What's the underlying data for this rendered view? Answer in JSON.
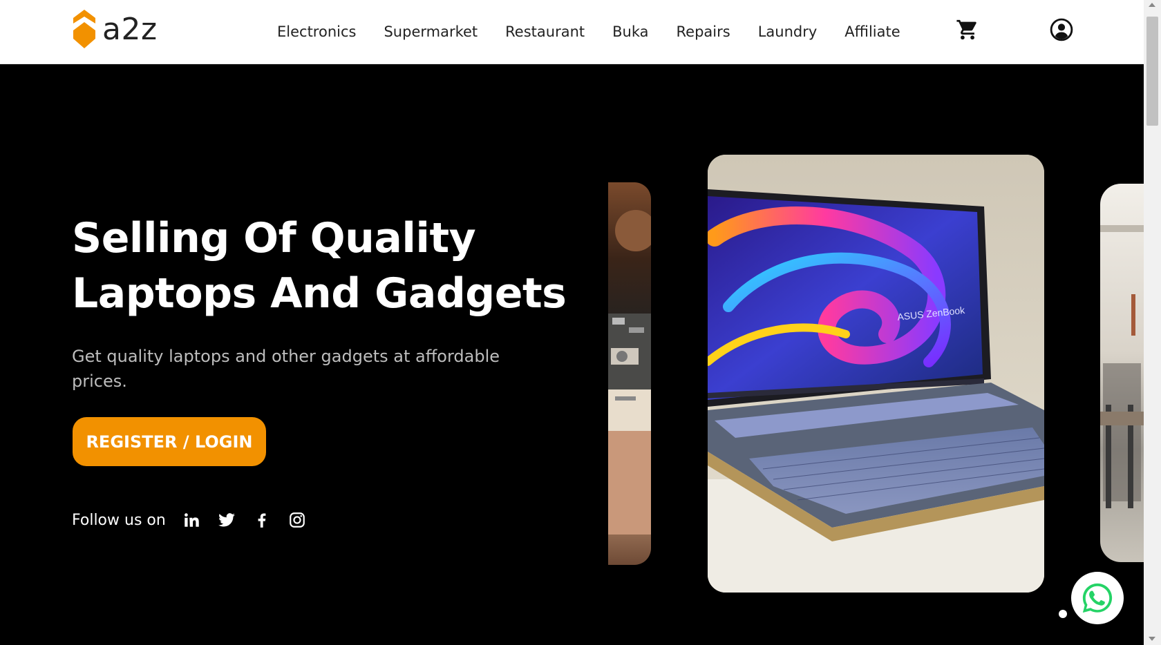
{
  "brand": {
    "name": "a2z",
    "accent": "#f29100"
  },
  "nav": {
    "items": [
      "Electronics",
      "Supermarket",
      "Restaurant",
      "Buka",
      "Repairs",
      "Laundry",
      "Affiliate"
    ]
  },
  "header_icons": [
    "cart-icon",
    "user-account-icon"
  ],
  "hero": {
    "title": "Selling Of Quality Laptops And Gadgets",
    "subtitle": "Get quality laptops and other gadgets at affordable prices.",
    "cta": "REGISTER / LOGIN",
    "follow_label": "Follow us on",
    "socials": [
      "linkedin-icon",
      "twitter-icon",
      "facebook-icon",
      "instagram-icon"
    ]
  },
  "carousel": {
    "main_laptop_label": "ASUS ZenBook",
    "active_slide": 1
  }
}
